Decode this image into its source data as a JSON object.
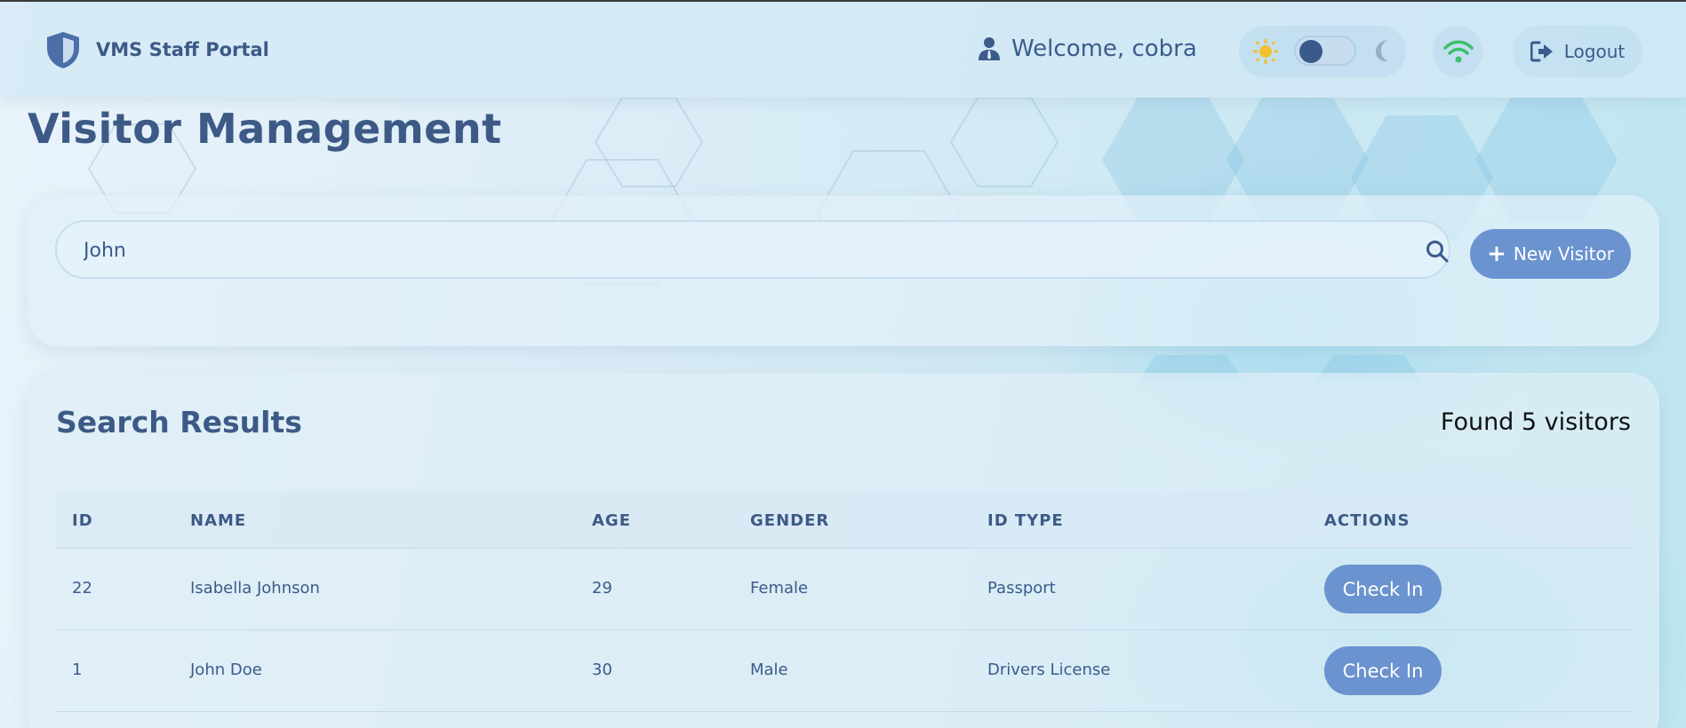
{
  "header": {
    "brand_name": "VMS Staff Portal",
    "welcome_text": "Welcome, cobra",
    "logout_label": "Logout"
  },
  "page": {
    "title": "Visitor Management"
  },
  "search": {
    "value": "John",
    "new_visitor_plus": "+",
    "new_visitor_label": "New Visitor"
  },
  "results": {
    "title": "Search Results",
    "count_text": "Found 5 visitors",
    "columns": [
      "ID",
      "NAME",
      "AGE",
      "GENDER",
      "ID TYPE",
      "ACTIONS"
    ],
    "rows": [
      {
        "id": "22",
        "name": "Isabella Johnson",
        "age": "29",
        "gender": "Female",
        "id_type": "Passport",
        "action": "Check In"
      },
      {
        "id": "1",
        "name": "John Doe",
        "age": "30",
        "gender": "Male",
        "id_type": "Drivers License",
        "action": "Check In"
      }
    ]
  },
  "colors": {
    "primary_button": "#6a93cf",
    "text_primary": "#3d5a86",
    "sun": "#f2c12e",
    "wifi": "#3cc06a"
  },
  "icons": [
    "shield-icon",
    "user-icon",
    "sun-icon",
    "moon-icon",
    "wifi-icon",
    "logout-icon",
    "search-icon",
    "plus-icon"
  ]
}
